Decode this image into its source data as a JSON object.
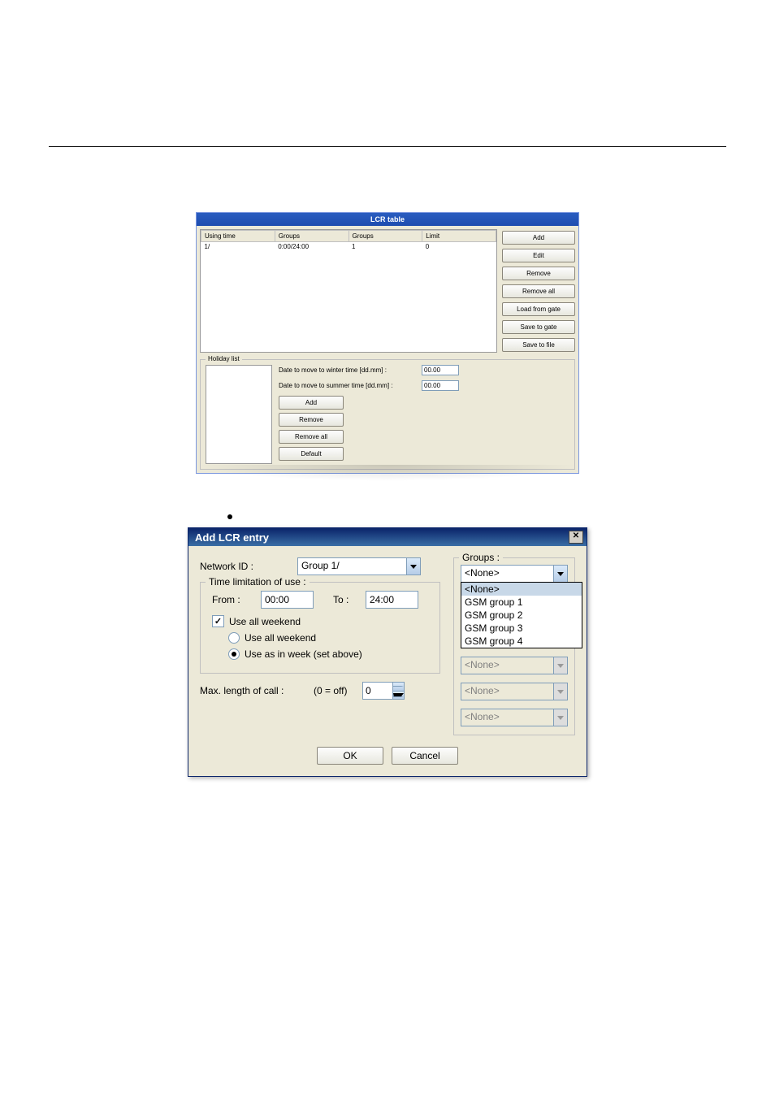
{
  "lcr_table": {
    "title": "LCR table",
    "columns": [
      "Using time",
      "Groups",
      "Groups",
      "Limit"
    ],
    "rows": [
      {
        "using_time": "1/",
        "groups1": "0:00/24:00",
        "groups2": "1",
        "limit": "0"
      }
    ],
    "buttons": {
      "add": "Add",
      "edit": "Edit",
      "remove": "Remove",
      "remove_all": "Remove all",
      "load_from_gate": "Load from gate",
      "save_to_gate": "Save to gate",
      "save_to_file": "Save to file"
    },
    "holiday": {
      "legend": "Holiday list",
      "winter_label": "Date to move to winter time [dd.mm] :",
      "winter_value": "00.00",
      "summer_label": "Date to move to summer time [dd.mm] :",
      "summer_value": "00.00",
      "buttons": {
        "add": "Add",
        "remove": "Remove",
        "remove_all": "Remove all",
        "default": "Default"
      }
    }
  },
  "dialog": {
    "title": "Add LCR entry",
    "network_id_label": "Network ID :",
    "network_id_value": "Group 1/",
    "time_legend": "Time limitation of use :",
    "from_label": "From :",
    "from_value": "00:00",
    "to_label": "To :",
    "to_value": "24:00",
    "use_all_weekend_chk": "Use all weekend",
    "radio_all_weekend": "Use all weekend",
    "radio_as_week": "Use as in week (set above)",
    "max_len_label": "Max. length of call :",
    "max_len_hint": "(0 = off)",
    "max_len_value": "0",
    "groups_legend": "Groups :",
    "group_selected": "<None>",
    "group_options": [
      "<None>",
      "GSM group 1",
      "GSM group 2",
      "GSM group 3",
      "GSM group 4"
    ],
    "disabled_value": "<None>",
    "ok": "OK",
    "cancel": "Cancel"
  }
}
